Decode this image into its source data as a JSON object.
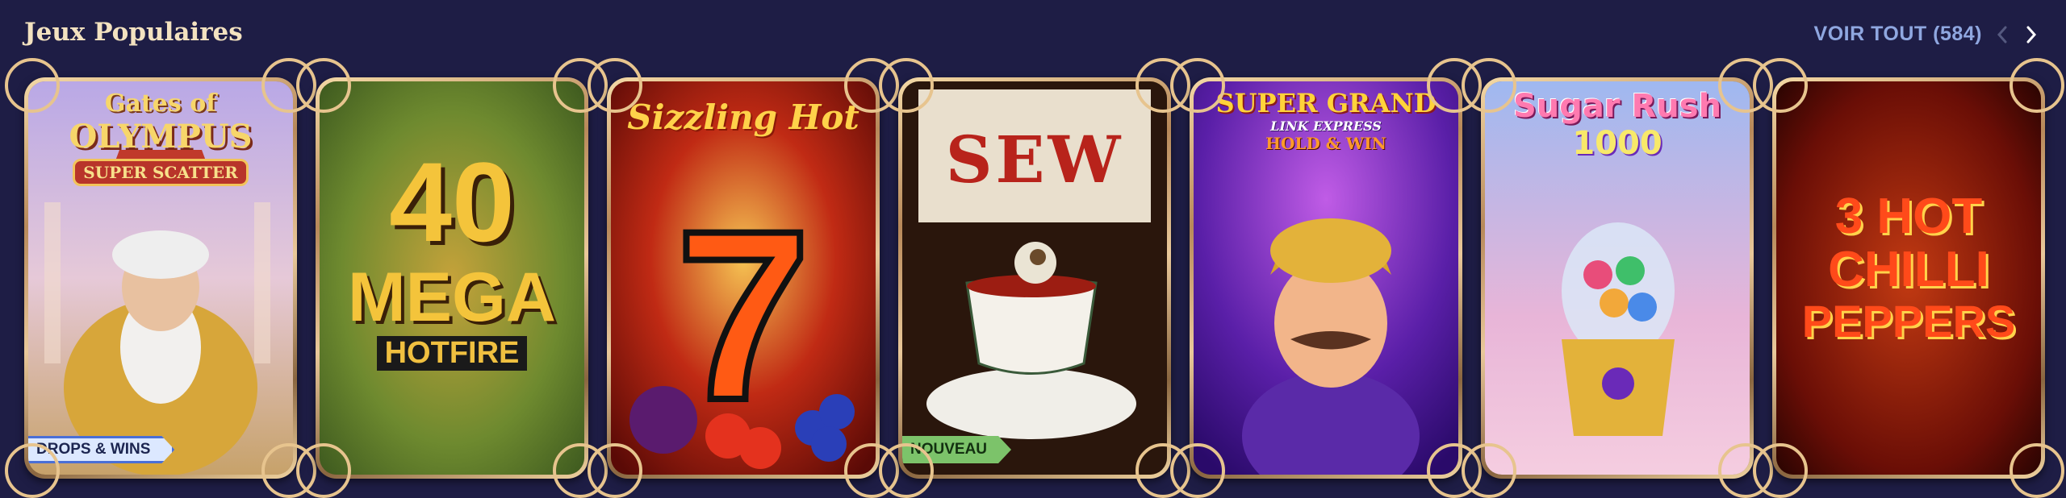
{
  "section": {
    "title": "Jeux Populaires",
    "view_all_label": "VOIR TOUT (584)",
    "prev_icon": "chevron-left-icon",
    "next_icon": "chevron-right-icon"
  },
  "games": [
    {
      "title_line1": "Gates of",
      "title_line2": "OLYMPUS",
      "title_line3": "SUPER SCATTER",
      "badge": "DROPS & WINS"
    },
    {
      "title_line1": "40",
      "title_line2": "MEGA",
      "title_line3": "HOTFIRE"
    },
    {
      "title_line1": "Sizzling Hot",
      "title_line2": "7"
    },
    {
      "title_line1": "SEW",
      "badge": "NOUVEAU"
    },
    {
      "title_line1": "SUPER GRAND",
      "title_line2": "LINK EXPRESS",
      "title_line3": "HOLD & WIN"
    },
    {
      "title_line1": "Sugar Rush",
      "title_line2": "1000"
    },
    {
      "title_line1": "3 HOT",
      "title_line2": "CHILLI",
      "title_line3": "PEPPERS"
    }
  ],
  "colors": {
    "background": "#1e1d45",
    "title": "#f3e2c0",
    "link": "#8fa7e0",
    "card_frame": "#e7c48e"
  }
}
